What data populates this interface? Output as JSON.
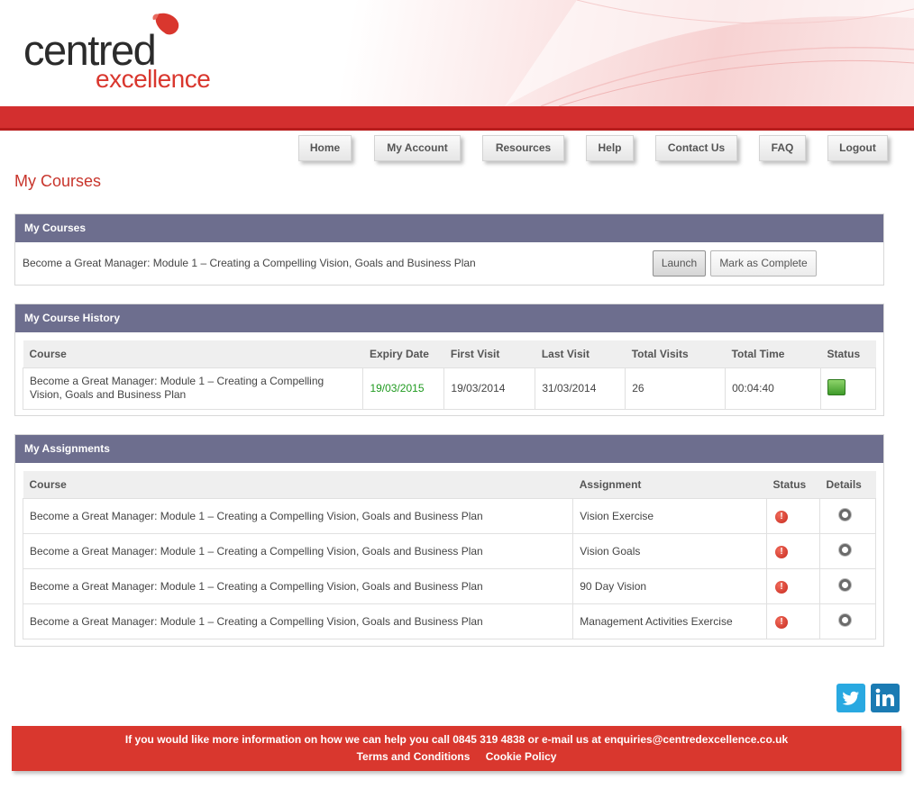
{
  "brand": {
    "word1": "centred",
    "word2": "excellence",
    "primary_color": "#d9372e",
    "header_bar_color": "#6d6e8e"
  },
  "nav": {
    "items": [
      {
        "label": "Home"
      },
      {
        "label": "My Account"
      },
      {
        "label": "Resources"
      },
      {
        "label": "Help"
      },
      {
        "label": "Contact Us"
      },
      {
        "label": "FAQ"
      },
      {
        "label": "Logout"
      }
    ]
  },
  "page_title": "My Courses",
  "my_courses": {
    "heading": "My Courses",
    "course_name": "Become a Great Manager: Module 1 – Creating a Compelling Vision, Goals and Business Plan",
    "launch_label": "Launch",
    "complete_label": "Mark as Complete"
  },
  "history": {
    "heading": "My Course History",
    "columns": [
      "Course",
      "Expiry Date",
      "First Visit",
      "Last Visit",
      "Total Visits",
      "Total Time",
      "Status"
    ],
    "rows": [
      {
        "course": "Become a Great Manager: Module 1 – Creating a Compelling Vision, Goals and Business Plan",
        "expiry": "19/03/2015",
        "first_visit": "19/03/2014",
        "last_visit": "31/03/2014",
        "total_visits": "26",
        "total_time": "00:04:40",
        "status_icon": "green-status-icon"
      }
    ]
  },
  "assignments": {
    "heading": "My Assignments",
    "columns": [
      "Course",
      "Assignment",
      "Status",
      "Details"
    ],
    "rows": [
      {
        "course": "Become a Great Manager: Module 1 – Creating a Compelling Vision, Goals and Business Plan",
        "assignment": "Vision Exercise",
        "status_icon": "alert-icon",
        "details_icon": "details-icon"
      },
      {
        "course": "Become a Great Manager: Module 1 – Creating a Compelling Vision, Goals and Business Plan",
        "assignment": "Vision Goals",
        "status_icon": "alert-icon",
        "details_icon": "details-icon"
      },
      {
        "course": "Become a Great Manager: Module 1 – Creating a Compelling Vision, Goals and Business Plan",
        "assignment": "90 Day Vision",
        "status_icon": "alert-icon",
        "details_icon": "details-icon"
      },
      {
        "course": "Become a Great Manager: Module 1 – Creating a Compelling Vision, Goals and Business Plan",
        "assignment": "Management Activities Exercise",
        "status_icon": "alert-icon",
        "details_icon": "details-icon"
      }
    ]
  },
  "social": {
    "twitter_icon": "twitter-icon",
    "linkedin_icon": "linkedin-icon",
    "twitter_color": "#29a9e1",
    "linkedin_color": "#1b7bb3"
  },
  "footer": {
    "contact_text": "If you would like more information on how we can help you call 0845 319 4838 or e-mail us at enquiries@centredexcellence.co.uk",
    "terms_label": "Terms and Conditions",
    "cookie_label": "Cookie Policy"
  }
}
